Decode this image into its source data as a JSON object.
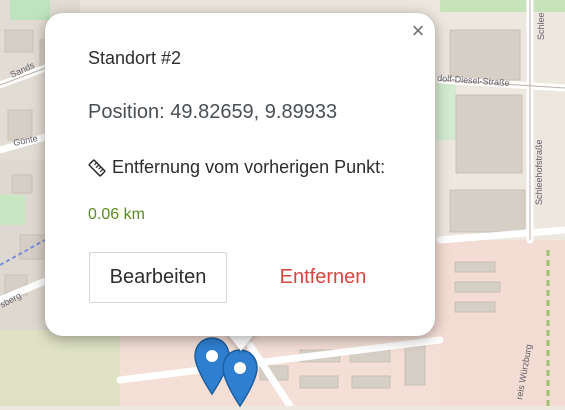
{
  "popup": {
    "close_glyph": "×",
    "title": "Standort #2",
    "position_text": "Position: 49.82659, 9.89933",
    "distance_label": "Entfernung vom vorherigen Punkt:",
    "distance_value": "0.06 km",
    "edit_label": "Bearbeiten",
    "remove_label": "Entfernen",
    "icons": {
      "close": "close-icon",
      "distance": "ruler-icon"
    },
    "colors": {
      "distance": "#5b8a1f",
      "remove": "#d9463f"
    }
  },
  "map": {
    "street_labels": {
      "sandstrasse": "Sands",
      "guenter": "Günte",
      "diesel": "dolf-Diesel-Straße",
      "schlee_top": "Schlee",
      "schleehof": "Schleehofstraße",
      "kreis": "reis Würzburg",
      "burg": "sberg"
    },
    "markers": [
      {
        "icon": "map-marker-icon",
        "color": "#2f7fd0"
      },
      {
        "icon": "map-marker-icon",
        "color": "#2f7fd0"
      }
    ]
  }
}
